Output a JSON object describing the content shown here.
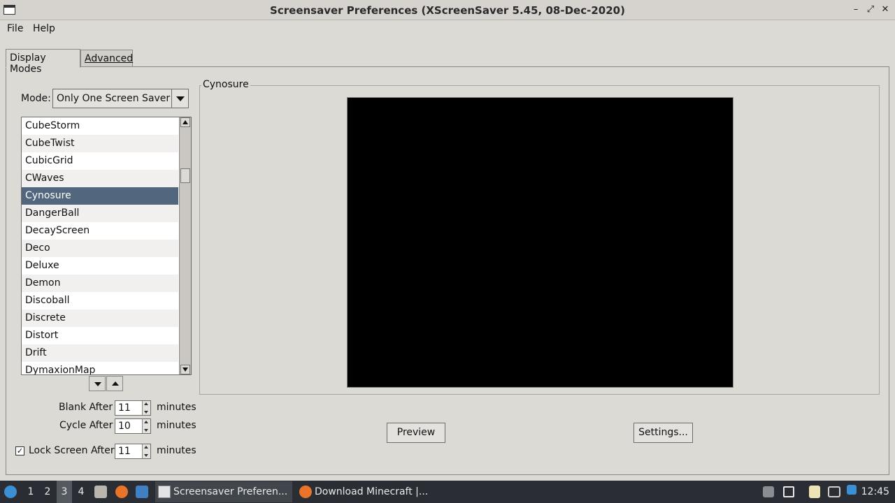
{
  "window": {
    "title": "Screensaver Preferences  (XScreenSaver 5.45, 08-Dec-2020)",
    "controls": {
      "minimize": "–",
      "maximize": "⤢",
      "close": "✕"
    }
  },
  "menu": {
    "file": "File",
    "help": "Help"
  },
  "tabs": {
    "display_modes": "Display Modes",
    "advanced": "Advanced"
  },
  "mode": {
    "label": "Mode:",
    "value": "Only One Screen Saver"
  },
  "savers": {
    "items": [
      "CubeStorm",
      "CubeTwist",
      "CubicGrid",
      "CWaves",
      "Cynosure",
      "DangerBall",
      "DecayScreen",
      "Deco",
      "Deluxe",
      "Demon",
      "Discoball",
      "Discrete",
      "Distort",
      "Drift",
      "DymaxionMap"
    ],
    "selected_index": 4
  },
  "timing": {
    "blank_after": {
      "label": "Blank After",
      "value": "11",
      "unit": "minutes"
    },
    "cycle_after": {
      "label": "Cycle After",
      "value": "10",
      "unit": "minutes"
    },
    "lock_after": {
      "label": "Lock Screen After",
      "value": "11",
      "unit": "minutes",
      "checked": true,
      "check_glyph": "✓"
    }
  },
  "preview": {
    "frame_title": "Cynosure",
    "preview_button": "Preview",
    "settings_button": "Settings..."
  },
  "taskbar": {
    "workspaces": [
      "1",
      "2",
      "3",
      "4"
    ],
    "active_workspace": "3",
    "tasks": [
      {
        "label": "Screensaver Preferen...",
        "active": true
      },
      {
        "label": "Download Minecraft |...",
        "active": false
      }
    ],
    "clock": "12:45"
  },
  "colors": {
    "selection": "#52667e",
    "taskbar": "#2a2d33",
    "window_bg": "#dcdad5"
  }
}
